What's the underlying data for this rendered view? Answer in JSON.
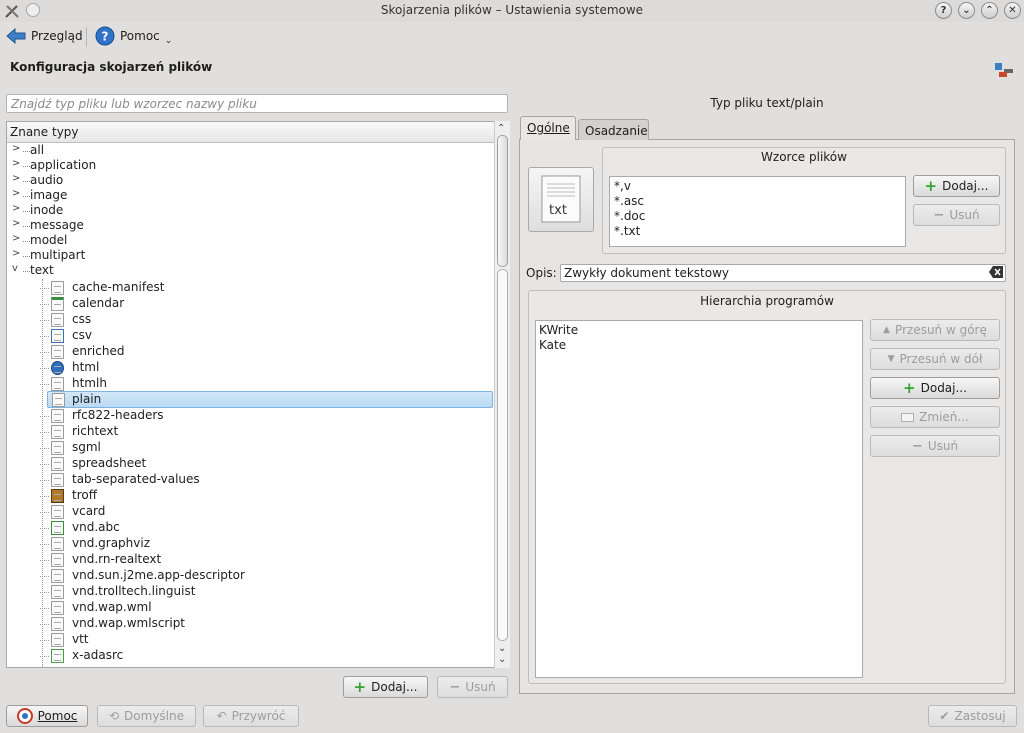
{
  "window": {
    "title": "Skojarzenia plików – Ustawienia systemowe",
    "controls": [
      "?",
      "⌄",
      "⌃",
      "✕"
    ]
  },
  "toolbar": {
    "overview_label": "Przegląd",
    "help_label": "Pomoc"
  },
  "page": {
    "heading": "Konfiguracja skojarzeń plików"
  },
  "search": {
    "placeholder": "Znajdź typ pliku lub wzorzec nazwy pliku",
    "value": ""
  },
  "tree": {
    "header": "Znane typy",
    "groups": [
      "all",
      "application",
      "audio",
      "image",
      "inode",
      "message",
      "model",
      "multipart",
      "text"
    ],
    "expanded_group": "text",
    "children": [
      {
        "label": "cache-manifest",
        "icon": "text-file-icon"
      },
      {
        "label": "calendar",
        "icon": "calendar-icon"
      },
      {
        "label": "css",
        "icon": "text-file-icon"
      },
      {
        "label": "csv",
        "icon": "spreadsheet-icon"
      },
      {
        "label": "enriched",
        "icon": "text-file-icon"
      },
      {
        "label": "html",
        "icon": "globe-icon"
      },
      {
        "label": "htmlh",
        "icon": "text-file-icon"
      },
      {
        "label": "plain",
        "icon": "text-file-icon"
      },
      {
        "label": "rfc822-headers",
        "icon": "text-file-icon"
      },
      {
        "label": "richtext",
        "icon": "text-file-icon"
      },
      {
        "label": "sgml",
        "icon": "text-file-icon"
      },
      {
        "label": "spreadsheet",
        "icon": "text-file-icon"
      },
      {
        "label": "tab-separated-values",
        "icon": "text-file-icon"
      },
      {
        "label": "troff",
        "icon": "book-icon"
      },
      {
        "label": "vcard",
        "icon": "text-file-icon"
      },
      {
        "label": "vnd.abc",
        "icon": "music-note-icon"
      },
      {
        "label": "vnd.graphviz",
        "icon": "text-file-icon"
      },
      {
        "label": "vnd.rn-realtext",
        "icon": "text-file-icon"
      },
      {
        "label": "vnd.sun.j2me.app-descriptor",
        "icon": "text-file-icon"
      },
      {
        "label": "vnd.trolltech.linguist",
        "icon": "text-file-icon"
      },
      {
        "label": "vnd.wap.wml",
        "icon": "text-file-icon"
      },
      {
        "label": "vnd.wap.wmlscript",
        "icon": "text-file-icon"
      },
      {
        "label": "vtt",
        "icon": "text-file-icon"
      },
      {
        "label": "x-adasrc",
        "icon": "source-file-icon"
      }
    ],
    "selected": "plain"
  },
  "left_buttons": {
    "add_label": "Dodaj...",
    "remove_label": "Usuń"
  },
  "right": {
    "title": "Typ pliku text/plain",
    "tabs": [
      "Ogólne",
      "Osadzanie"
    ],
    "icon_text": "txt",
    "patterns": {
      "title": "Wzorce plików",
      "items": [
        "*,v",
        "*.asc",
        "*.doc",
        "*.txt"
      ],
      "add_label": "Dodaj...",
      "remove_label": "Usuń"
    },
    "description": {
      "label": "Opis:",
      "value": "Zwykły dokument tekstowy"
    },
    "apps": {
      "title": "Hierarchia programów",
      "items": [
        "KWrite",
        "Kate"
      ],
      "up_label": "Przesuń w górę",
      "down_label": "Przesuń w dół",
      "add_label": "Dodaj...",
      "edit_label": "Zmień...",
      "remove_label": "Usuń"
    }
  },
  "footer": {
    "help_label": "Pomoc",
    "defaults_label": "Domyślne",
    "reset_label": "Przywróć",
    "apply_label": "Zastosuj"
  }
}
